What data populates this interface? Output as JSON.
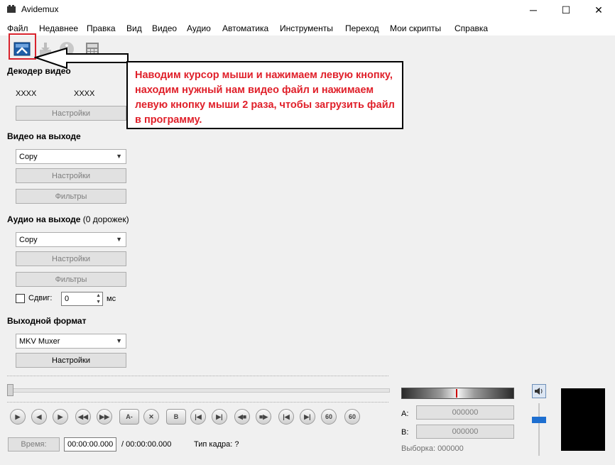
{
  "window": {
    "title": "Avidemux",
    "minimize": "─",
    "maximize": "☐",
    "close": "✕"
  },
  "menu": [
    "Файл",
    "Недавнее",
    "Правка",
    "Вид",
    "Видео",
    "Аудио",
    "Автоматика",
    "Инструменты",
    "Переход",
    "Мои скрипты",
    "Справка"
  ],
  "video_decoder": {
    "heading": "Декодер видео",
    "codec_a": "XXXX",
    "codec_b": "XXXX",
    "settings": "Настройки"
  },
  "video_output": {
    "heading": "Видео на выходе",
    "codec": "Copy",
    "settings": "Настройки",
    "filters": "Фильтры"
  },
  "audio_output": {
    "heading": "Аудио на выходе",
    "tracks": "(0 дорожек)",
    "codec": "Copy",
    "settings": "Настройки",
    "filters": "Фильтры",
    "shift_label": "Сдвиг:",
    "shift_value": "0",
    "shift_unit": "мс"
  },
  "output_format": {
    "heading": "Выходной формат",
    "muxer": "MKV Muxer",
    "settings": "Настройки"
  },
  "callout": {
    "text": "Наводим курсор мыши и нажимаем левую кнопку, находим нужный нам видео файл и нажимаем левую кнопку мыши 2 раза, чтобы загрузить файл в программу."
  },
  "controls": {
    "a_label": "A-",
    "b_label": "B",
    "fps60a": "60",
    "fps60b": "60"
  },
  "status": {
    "time_button": "Время:",
    "current_time": "00:00:00.000",
    "total_time": "/ 00:00:00.000",
    "frame_type": "Тип кадра:  ?"
  },
  "markers": {
    "a_label": "A:",
    "a_value": "000000",
    "b_label": "B:",
    "b_value": "000000",
    "selection": "Выборка: 000000"
  },
  "icons": {
    "open": "open-video-icon",
    "save": "save-icon",
    "info": "info-icon",
    "calc": "calculator-icon"
  },
  "colors": {
    "accent": "#d9232d",
    "callout_text": "#e0202a",
    "volume": "#1e6fd0"
  }
}
